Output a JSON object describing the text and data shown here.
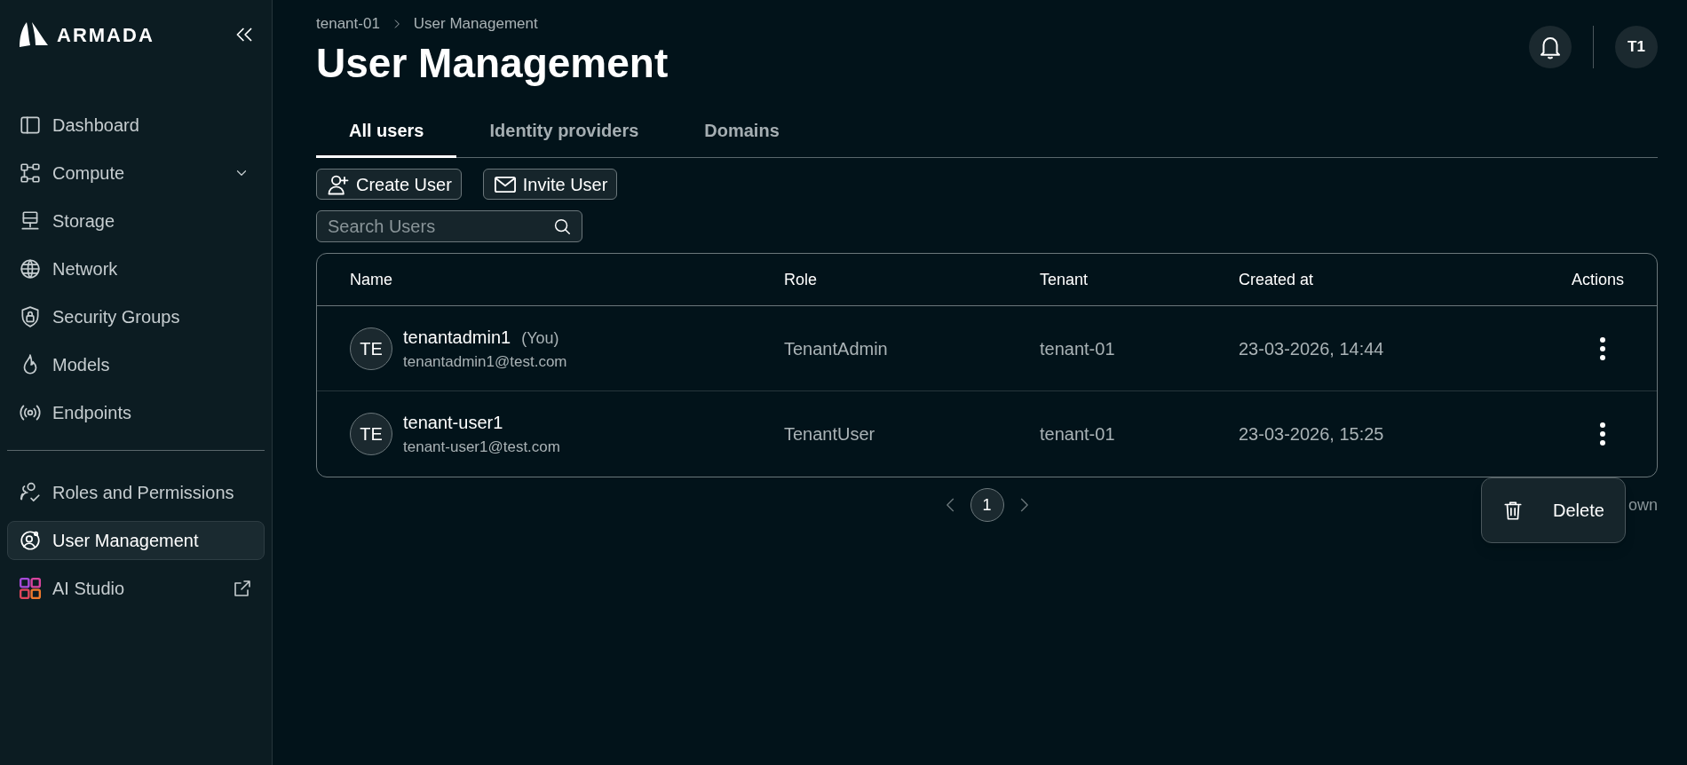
{
  "sidebar": {
    "brand": "ARMADA",
    "items": [
      {
        "label": "Dashboard",
        "selected": false
      },
      {
        "label": "Compute",
        "selected": false,
        "expandable": true
      },
      {
        "label": "Storage",
        "selected": false
      },
      {
        "label": "Network",
        "selected": false
      },
      {
        "label": "Security Groups",
        "selected": false
      },
      {
        "label": "Models",
        "selected": false
      },
      {
        "label": "Endpoints",
        "selected": false
      }
    ],
    "bottom_items": [
      {
        "label": "Roles and Permissions",
        "selected": false
      },
      {
        "label": "User Management",
        "selected": true
      },
      {
        "label": "AI Studio",
        "selected": false,
        "external": true
      }
    ]
  },
  "header": {
    "breadcrumb": [
      "tenant-01",
      "User Management"
    ],
    "title": "User Management",
    "avatar": "T1"
  },
  "tabs": [
    {
      "label": "All users",
      "selected": true
    },
    {
      "label": "Identity providers",
      "selected": false
    },
    {
      "label": "Domains",
      "selected": false
    }
  ],
  "buttons": [
    "Create User",
    "Invite User"
  ],
  "search": {
    "placeholder": "Search Users"
  },
  "table": {
    "columns": [
      "Name",
      "Role",
      "Tenant",
      "Created at",
      "Actions"
    ],
    "rows": [
      {
        "initials": "TE",
        "name": "tenantadmin1",
        "tag": "(You)",
        "email": "tenantadmin1@test.com",
        "role": "TenantAdmin",
        "tenant": "tenant-01",
        "created": "23-03-2026, 14:44"
      },
      {
        "initials": "TE",
        "name": "tenant-user1",
        "email": "tenant-user1@test.com",
        "role": "TenantUser",
        "tenant": "tenant-01",
        "created": "23-03-2026, 15:25"
      }
    ]
  },
  "pagination": {
    "pages": [
      {
        "label": "1",
        "selected": true
      }
    ],
    "info_fragment": "own"
  },
  "context_menu": {
    "items": [
      "Delete"
    ]
  }
}
